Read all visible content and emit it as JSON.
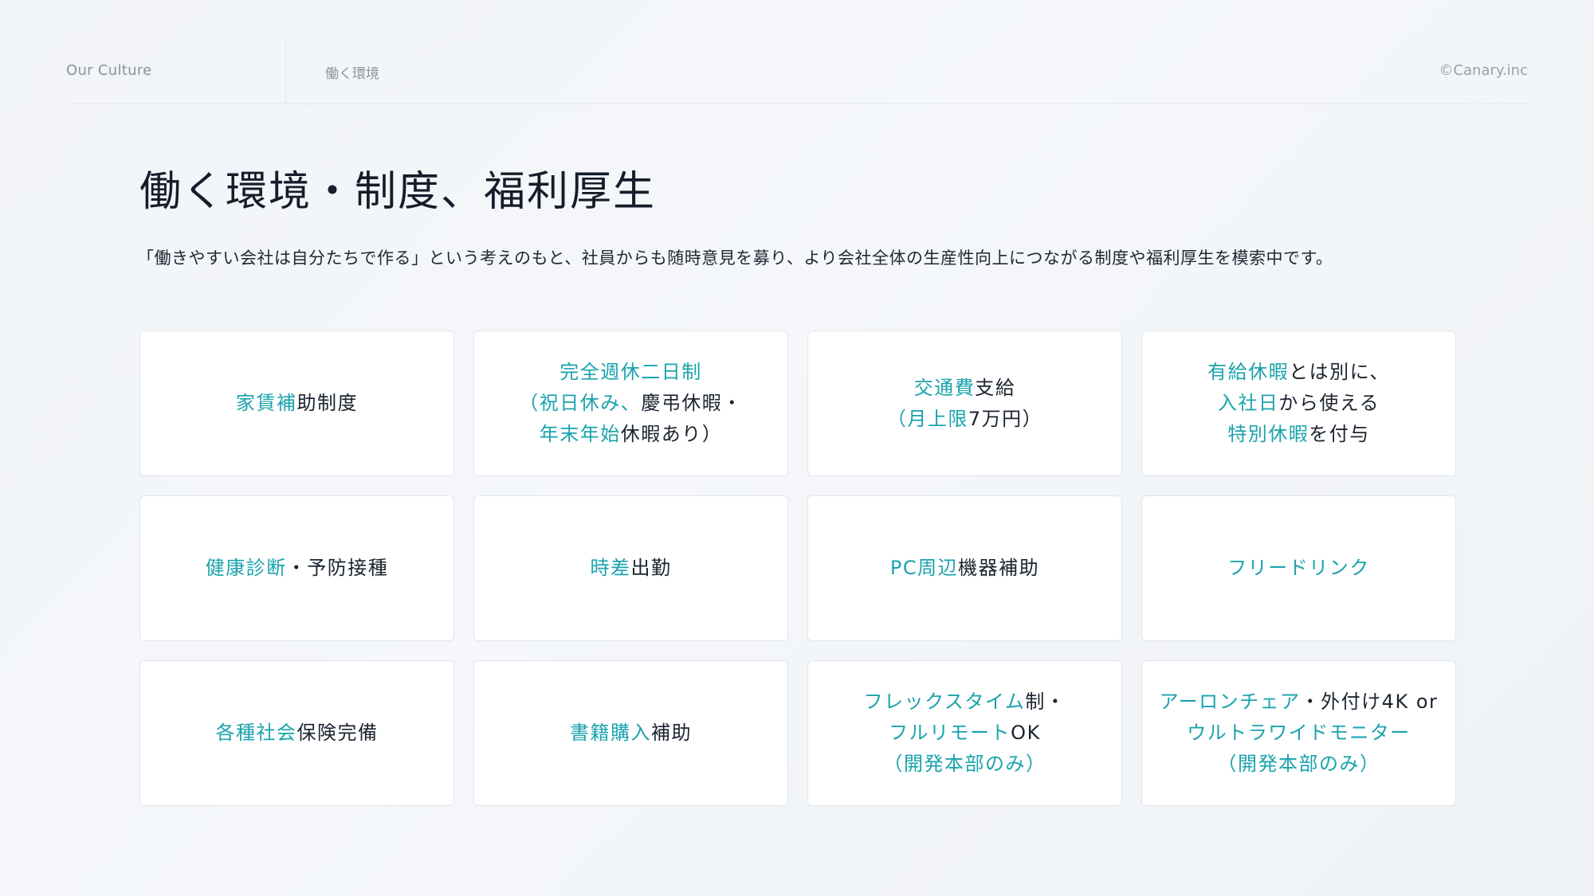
{
  "header": {
    "section": "Our Culture",
    "page": "働く環境",
    "copyright": "©Canary.inc"
  },
  "title": "働く環境・制度、福利厚生",
  "description": "「働きやすい会社は自分たちで作る」という考えのもと、社員からも随時意見を募り、より会社全体の生産性向上につながる制度や福利厚生を模索中です。",
  "colors": {
    "accent": "#1aa3ad",
    "text": "#1c2430"
  },
  "cards": [
    {
      "id": "rent-subsidy",
      "lines": [
        [
          {
            "t": "家賃補",
            "h": true
          },
          {
            "t": "助制度",
            "h": false
          }
        ]
      ]
    },
    {
      "id": "two-day-weekend",
      "lines": [
        [
          {
            "t": "完全週休二日制",
            "h": true
          }
        ],
        [
          {
            "t": "（祝日休み、",
            "h": true
          },
          {
            "t": "慶弔休暇・",
            "h": false
          }
        ],
        [
          {
            "t": "年末年始",
            "h": true
          },
          {
            "t": "休暇あり）",
            "h": false
          }
        ]
      ]
    },
    {
      "id": "transport-allowance",
      "lines": [
        [
          {
            "t": "交通費",
            "h": true
          },
          {
            "t": "支給",
            "h": false
          }
        ],
        [
          {
            "t": "（月上限",
            "h": true
          },
          {
            "t": "7万円）",
            "h": false
          }
        ]
      ]
    },
    {
      "id": "special-leave",
      "lines": [
        [
          {
            "t": "有給休暇",
            "h": true
          },
          {
            "t": "とは別に、",
            "h": false
          }
        ],
        [
          {
            "t": "入社日",
            "h": true
          },
          {
            "t": "から使える",
            "h": false
          }
        ],
        [
          {
            "t": "特別休暇",
            "h": true
          },
          {
            "t": "を付与",
            "h": false
          }
        ]
      ]
    },
    {
      "id": "health-checkup",
      "lines": [
        [
          {
            "t": "健康診断",
            "h": true
          },
          {
            "t": "・予防接種",
            "h": false
          }
        ]
      ]
    },
    {
      "id": "staggered-hours",
      "lines": [
        [
          {
            "t": "時差",
            "h": true
          },
          {
            "t": "出勤",
            "h": false
          }
        ]
      ]
    },
    {
      "id": "pc-peripherals",
      "lines": [
        [
          {
            "t": "PC周辺",
            "h": true
          },
          {
            "t": "機器補助",
            "h": false
          }
        ]
      ]
    },
    {
      "id": "free-drinks",
      "lines": [
        [
          {
            "t": "フリードリンク",
            "h": true
          }
        ]
      ]
    },
    {
      "id": "social-insurance",
      "lines": [
        [
          {
            "t": "各種社会",
            "h": true
          },
          {
            "t": "保険完備",
            "h": false
          }
        ]
      ]
    },
    {
      "id": "book-purchase",
      "lines": [
        [
          {
            "t": "書籍購入",
            "h": true
          },
          {
            "t": "補助",
            "h": false
          }
        ]
      ]
    },
    {
      "id": "flex-remote",
      "lines": [
        [
          {
            "t": "フレックスタイム",
            "h": true
          },
          {
            "t": "制・",
            "h": false
          }
        ],
        [
          {
            "t": "フルリモート",
            "h": true
          },
          {
            "t": "OK",
            "h": false
          }
        ],
        [
          {
            "t": "（開発本部のみ）",
            "h": true
          }
        ]
      ]
    },
    {
      "id": "aeron-chair",
      "lines": [
        [
          {
            "t": "アーロンチェア",
            "h": true
          },
          {
            "t": "・外付け4K or",
            "h": false
          }
        ],
        [
          {
            "t": "ウルトラワイドモニター",
            "h": true
          }
        ],
        [
          {
            "t": "（開発本部のみ）",
            "h": true
          }
        ]
      ]
    }
  ]
}
